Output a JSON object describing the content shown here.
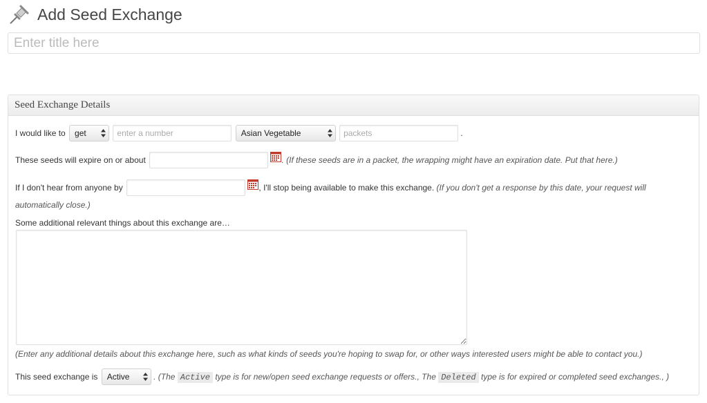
{
  "page": {
    "title": "Add Seed Exchange"
  },
  "title_field": {
    "placeholder": "Enter title here"
  },
  "box": {
    "title": "Seed Exchange Details",
    "row1": {
      "prefix": "I would like to",
      "action_value": "get",
      "quantity_placeholder": "enter a number",
      "category_value": "Asian Vegetable",
      "unit_placeholder": "packets",
      "suffix": "."
    },
    "row2": {
      "label": "These seeds will expire on or about",
      "note": ". (If these seeds are in a packet, the wrapping might have an expiration date. Put that here.)"
    },
    "row3": {
      "label": "If I don't hear from anyone by",
      "after": ", I'll stop being available to make this exchange.",
      "note_line1": "(If you don't get a response by this date, your request will",
      "note_line2": "automatically close.)"
    },
    "row4": {
      "label": "Some additional relevant things about this exchange are…"
    },
    "row5": {
      "note": "(Enter any additional details about this exchange here, such as what kinds of seeds you're hoping to swap for, or other ways interested users might be able to contact you.)"
    },
    "row6": {
      "label": "This seed exchange is",
      "status_value": "Active",
      "note_a": ". (The",
      "kw_active": "Active",
      "note_b": "type is for new/open seed exchange requests or offers., The",
      "kw_deleted": "Deleted",
      "note_c": "type is for expired or completed seed exchanges., )"
    }
  },
  "icons": {
    "page_icon": "pushpin-icon",
    "date_picker": "calendar-icon",
    "select_arrows": "updown-arrows-icon"
  }
}
